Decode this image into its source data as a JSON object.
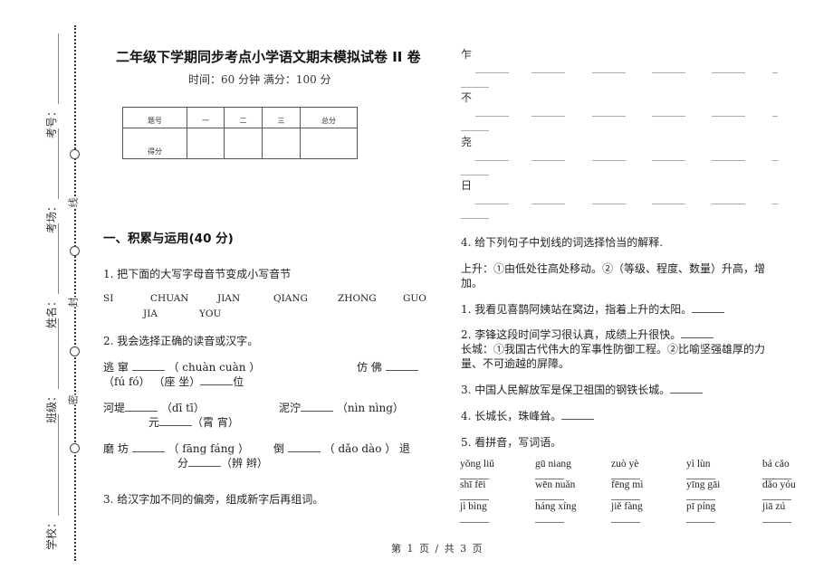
{
  "binding": {
    "fields": [
      {
        "label": "考号："
      },
      {
        "label": "考场："
      },
      {
        "label": "姓名："
      },
      {
        "label": "班级："
      },
      {
        "label": "学校："
      }
    ],
    "marks": [
      "线",
      "封",
      "密"
    ]
  },
  "header": {
    "title": "二年级下学期同步考点小学语文期末模拟试卷 II 卷",
    "subtitle": "时间：60 分钟   满分：100 分"
  },
  "score_table": {
    "headers": [
      "题号",
      "一",
      "二",
      "三",
      "总分"
    ],
    "row_label": "得分"
  },
  "section1": {
    "title": "一、积累与运用(40 分)",
    "q1": {
      "prompt": "1. 把下面的大写字母音节变成小写音节",
      "syllables": [
        "SI",
        "CHUAN",
        "JIAN",
        "QIANG",
        "ZHONG",
        "GUO",
        "JIA",
        "YOU"
      ]
    },
    "q2": {
      "prompt": "2. 我会选择正确的读音或汉字。",
      "lines": [
        {
          "a": "逃 窜",
          "b": "（ chuàn    cuàn ）",
          "c": "仿 佛"
        },
        {
          "a": "（fú   fó） （座   坐）",
          "b": "位"
        },
        {
          "a": "河堤",
          "b": "（dī   tī）",
          "c": "泥泞",
          "d": "（nìn   nìng）"
        },
        {
          "a": "元",
          "b": "（霄   宵）"
        },
        {
          "a": "磨 坊",
          "b": "（ fāng    fáng ）",
          "c": "倒",
          "d": "（ dǎo    dào ） 退"
        },
        {
          "a": "分",
          "b": "（辨   辫）"
        }
      ]
    },
    "q3": {
      "prompt": "3. 给汉字加不同的偏旁，组成新字后再组词。",
      "chars": [
        "乍",
        "不",
        "尧",
        "日"
      ]
    },
    "q4": {
      "prompt": "4. 给下列句子中划线的词选择恰当的解释.",
      "def1": "上升：①由低处往高处移动。②（等级、程度、数量）升高，增",
      "def1b": "加。",
      "s1": "1. 我看见喜鹊阿姨站在窝边，指着上升的太阳。",
      "s2": "2. 李锋这段时间学习很认真，成绩上升很快。",
      "def2": "长城：①我国古代伟大的军事性防御工程。②比喻坚强雄厚的力",
      "def2b": "量、不可逾越的屏障。",
      "s3": "3. 中国人民解放军是保卫祖国的钢铁长城。",
      "s4": "4. 长城长，珠峰耸。"
    },
    "q5": {
      "prompt": "5.  看拼音，写词语。",
      "rows": [
        [
          "yǒng liǔ",
          "gū niang",
          "zuò yè",
          "yì lùn",
          "bá cǎo"
        ],
        [
          "shī fēi",
          "wēn nuǎn",
          "fēng mì",
          "yīng gāi",
          "dǎo yóu"
        ],
        [
          "jì bìng",
          "háng xíng",
          "jiě fàng",
          "pī píng",
          "jiā zú"
        ]
      ]
    }
  },
  "footer": {
    "page": "第 1 页  /  共 3 页"
  }
}
